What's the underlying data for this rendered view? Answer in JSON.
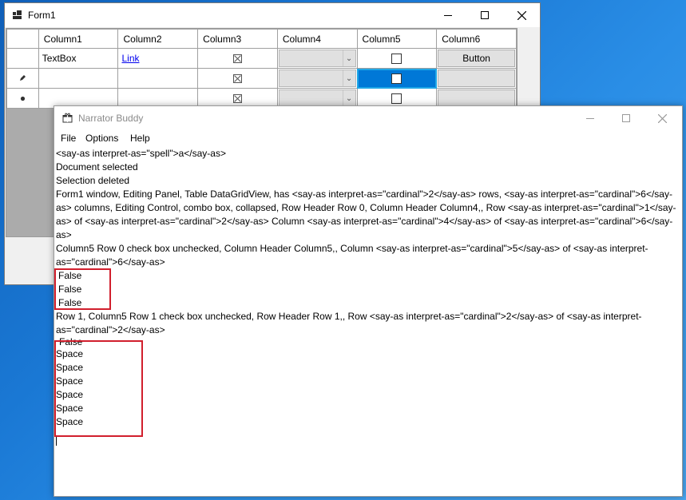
{
  "form1": {
    "title": "Form1",
    "grid": {
      "columns": [
        "Column1",
        "Column2",
        "Column3",
        "Column4",
        "Column5",
        "Column6"
      ],
      "rows": [
        {
          "header_icon": "",
          "col1": "TextBox",
          "col2": "Link",
          "col6": "Button"
        },
        {
          "header_icon": "pencil-icon",
          "col1": "",
          "col2": "",
          "col6": ""
        },
        {
          "header_icon": "asterisk-icon",
          "col1": "",
          "col2": "",
          "col6": ""
        }
      ]
    }
  },
  "narrator": {
    "title": "Narrator Buddy",
    "menu": [
      "File",
      "Options",
      "Help"
    ],
    "log": [
      "<say-as interpret-as=\"spell\">a</say-as>",
      "Document selected",
      "Selection deleted",
      "Form1 window, Editing Panel, Table DataGridView, has <say-as interpret-as=\"cardinal\">2</say-as> rows, <say-as interpret-as=\"cardinal\">6</say-as> columns, Editing Control, combo box, collapsed, Row Header Row 0, Column Header Column4,, Row <say-as interpret-as=\"cardinal\">1</say-as> of <say-as interpret-as=\"cardinal\">2</say-as> Column <say-as interpret-as=\"cardinal\">4</say-as> of <say-as interpret-as=\"cardinal\">6</say-as>",
      "Column5 Row 0 check box unchecked, Column Header Column5,, Column <say-as interpret-as=\"cardinal\">5</say-as> of <say-as interpret-as=\"cardinal\">6</say-as>",
      "False",
      "False",
      "False",
      "Row 1, Column5 Row 1 check box unchecked, Row Header Row 1,, Row <say-as interpret-as=\"cardinal\">2</say-as> of <say-as interpret-as=\"cardinal\">2</say-as>",
      "False",
      "Space",
      "Space",
      "Space",
      "Space",
      "Space",
      "Space"
    ]
  },
  "colors": {
    "selection_blue": "#0078d7",
    "highlight_red": "#d11f2d",
    "desktop_blue": "#1a78d4"
  }
}
